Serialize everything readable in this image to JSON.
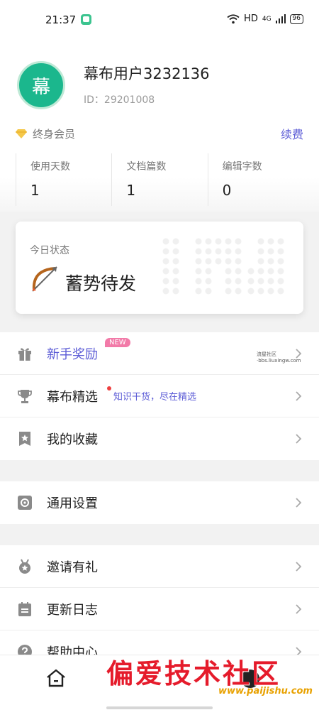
{
  "status_bar": {
    "time": "21:37",
    "network": "HD",
    "signal": "4G",
    "battery": "96"
  },
  "profile": {
    "avatar_text": "幕",
    "username": "幕布用户3232136",
    "user_id": "ID：29201008",
    "membership": "终身会员",
    "renew_label": "续费",
    "stats": [
      {
        "label": "使用天数",
        "value": "1"
      },
      {
        "label": "文档篇数",
        "value": "1"
      },
      {
        "label": "编辑字数",
        "value": "0"
      }
    ]
  },
  "today_status": {
    "label": "今日状态",
    "value": "蓄势待发"
  },
  "menu_group_1": [
    {
      "label": "新手奖励",
      "badge": "NEW",
      "icon": "gift-icon",
      "color": "#5b5bd6"
    },
    {
      "label": "幕布精选",
      "subtitle": "知识干货，尽在精选",
      "icon": "trophy-icon"
    },
    {
      "label": "我的收藏",
      "icon": "bookmark-star-icon"
    }
  ],
  "menu_group_2": [
    {
      "label": "通用设置",
      "icon": "settings-icon"
    }
  ],
  "menu_group_3": [
    {
      "label": "邀请有礼",
      "icon": "medal-icon"
    },
    {
      "label": "更新日志",
      "icon": "calendar-icon"
    },
    {
      "label": "帮助中心",
      "icon": "help-icon"
    }
  ],
  "watermark": {
    "main": "偏爱技术社区",
    "url": "www.paijishu.com",
    "small": "流星社区·bbs.liuxingw.com"
  },
  "colors": {
    "accent": "#5b5bd6",
    "avatar": "#1bb78d",
    "watermark": "#e51b2b"
  }
}
